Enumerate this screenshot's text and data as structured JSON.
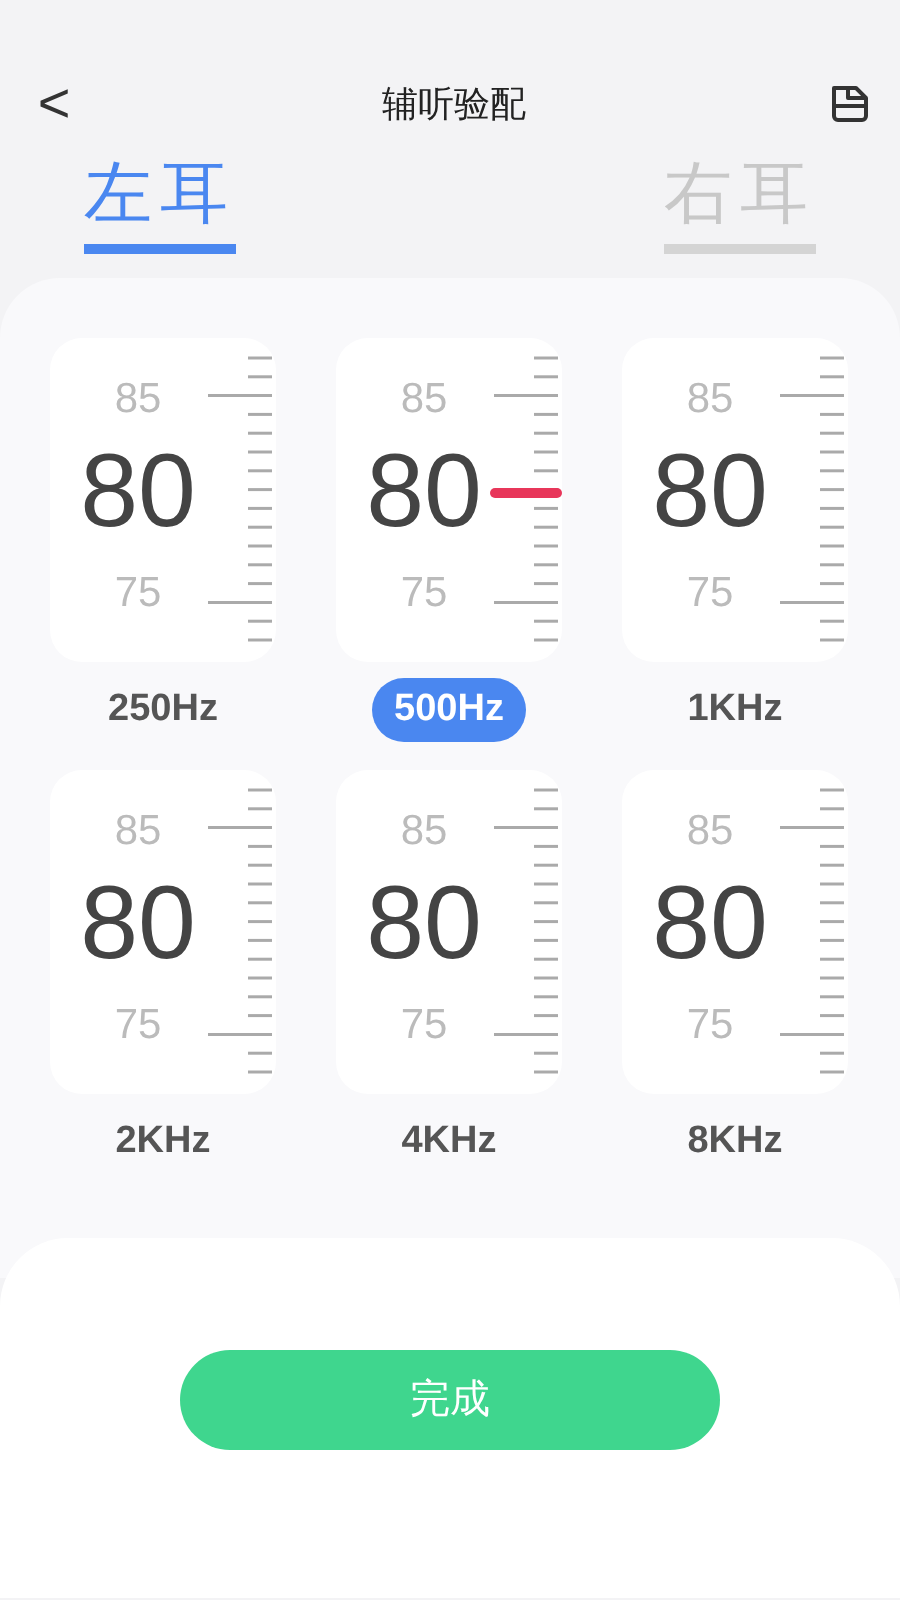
{
  "header": {
    "back": "<",
    "title": "辅听验配"
  },
  "tabs": [
    {
      "label": "左耳",
      "selected": true
    },
    {
      "label": "右耳",
      "selected": false
    }
  ],
  "bands": [
    {
      "upper": "85",
      "value": "80",
      "lower": "75",
      "label": "250Hz",
      "selected": false
    },
    {
      "upper": "85",
      "value": "80",
      "lower": "75",
      "label": "500Hz",
      "selected": true
    },
    {
      "upper": "85",
      "value": "80",
      "lower": "75",
      "label": "1KHz",
      "selected": false
    },
    {
      "upper": "85",
      "value": "80",
      "lower": "75",
      "label": "2KHz",
      "selected": false
    },
    {
      "upper": "85",
      "value": "80",
      "lower": "75",
      "label": "4KHz",
      "selected": false
    },
    {
      "upper": "85",
      "value": "80",
      "lower": "75",
      "label": "8KHz",
      "selected": false
    }
  ],
  "done_button": "完成"
}
